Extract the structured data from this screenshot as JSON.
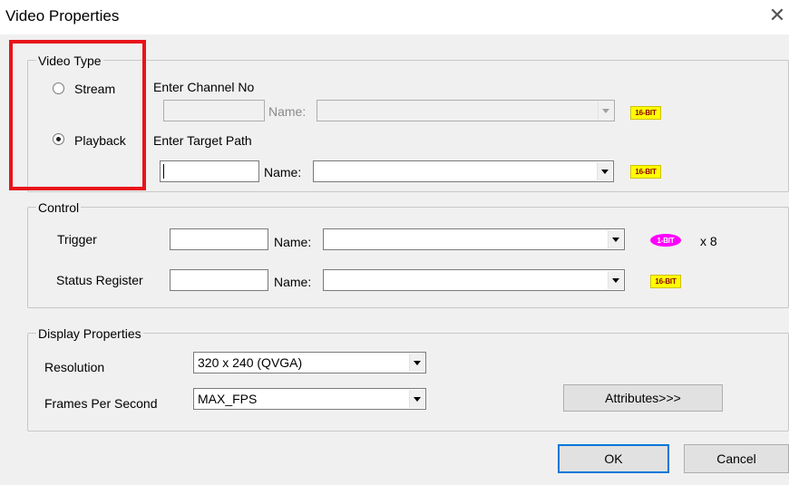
{
  "window": {
    "title": "Video Properties",
    "close_glyph": "✕"
  },
  "video_type": {
    "legend": "Video Type",
    "stream": {
      "label": "Stream",
      "selected": false
    },
    "playback": {
      "label": "Playback",
      "selected": true
    },
    "channel_label": "Enter Channel No",
    "channel_value": "",
    "channel_name_label": "Name:",
    "channel_name_value": "",
    "channel_badge": "16-BIT",
    "target_label": "Enter Target Path",
    "target_value": "",
    "target_name_label": "Name:",
    "target_name_value": "",
    "target_badge": "16-BIT"
  },
  "control": {
    "legend": "Control",
    "trigger_label": "Trigger",
    "trigger_value": "",
    "trigger_name_label": "Name:",
    "trigger_name_value": "",
    "trigger_badge": "1-BIT",
    "trigger_multiplier": "x 8",
    "status_label": "Status Register",
    "status_value": "",
    "status_name_label": "Name:",
    "status_name_value": "",
    "status_badge": "16-BIT"
  },
  "display": {
    "legend": "Display Properties",
    "resolution_label": "Resolution",
    "resolution_value": "320 x 240 (QVGA)",
    "fps_label": "Frames Per Second",
    "fps_value": "MAX_FPS",
    "attributes_button": "Attributes>>>"
  },
  "buttons": {
    "ok": "OK",
    "cancel": "Cancel"
  },
  "colors": {
    "highlight": "#e8141a",
    "badge_16bit": "#ffff00",
    "badge_1bit": "#ff00ff",
    "default_button_border": "#0078d7"
  },
  "icons": {
    "close": "close-icon",
    "dropdown": "chevron-down-icon"
  }
}
